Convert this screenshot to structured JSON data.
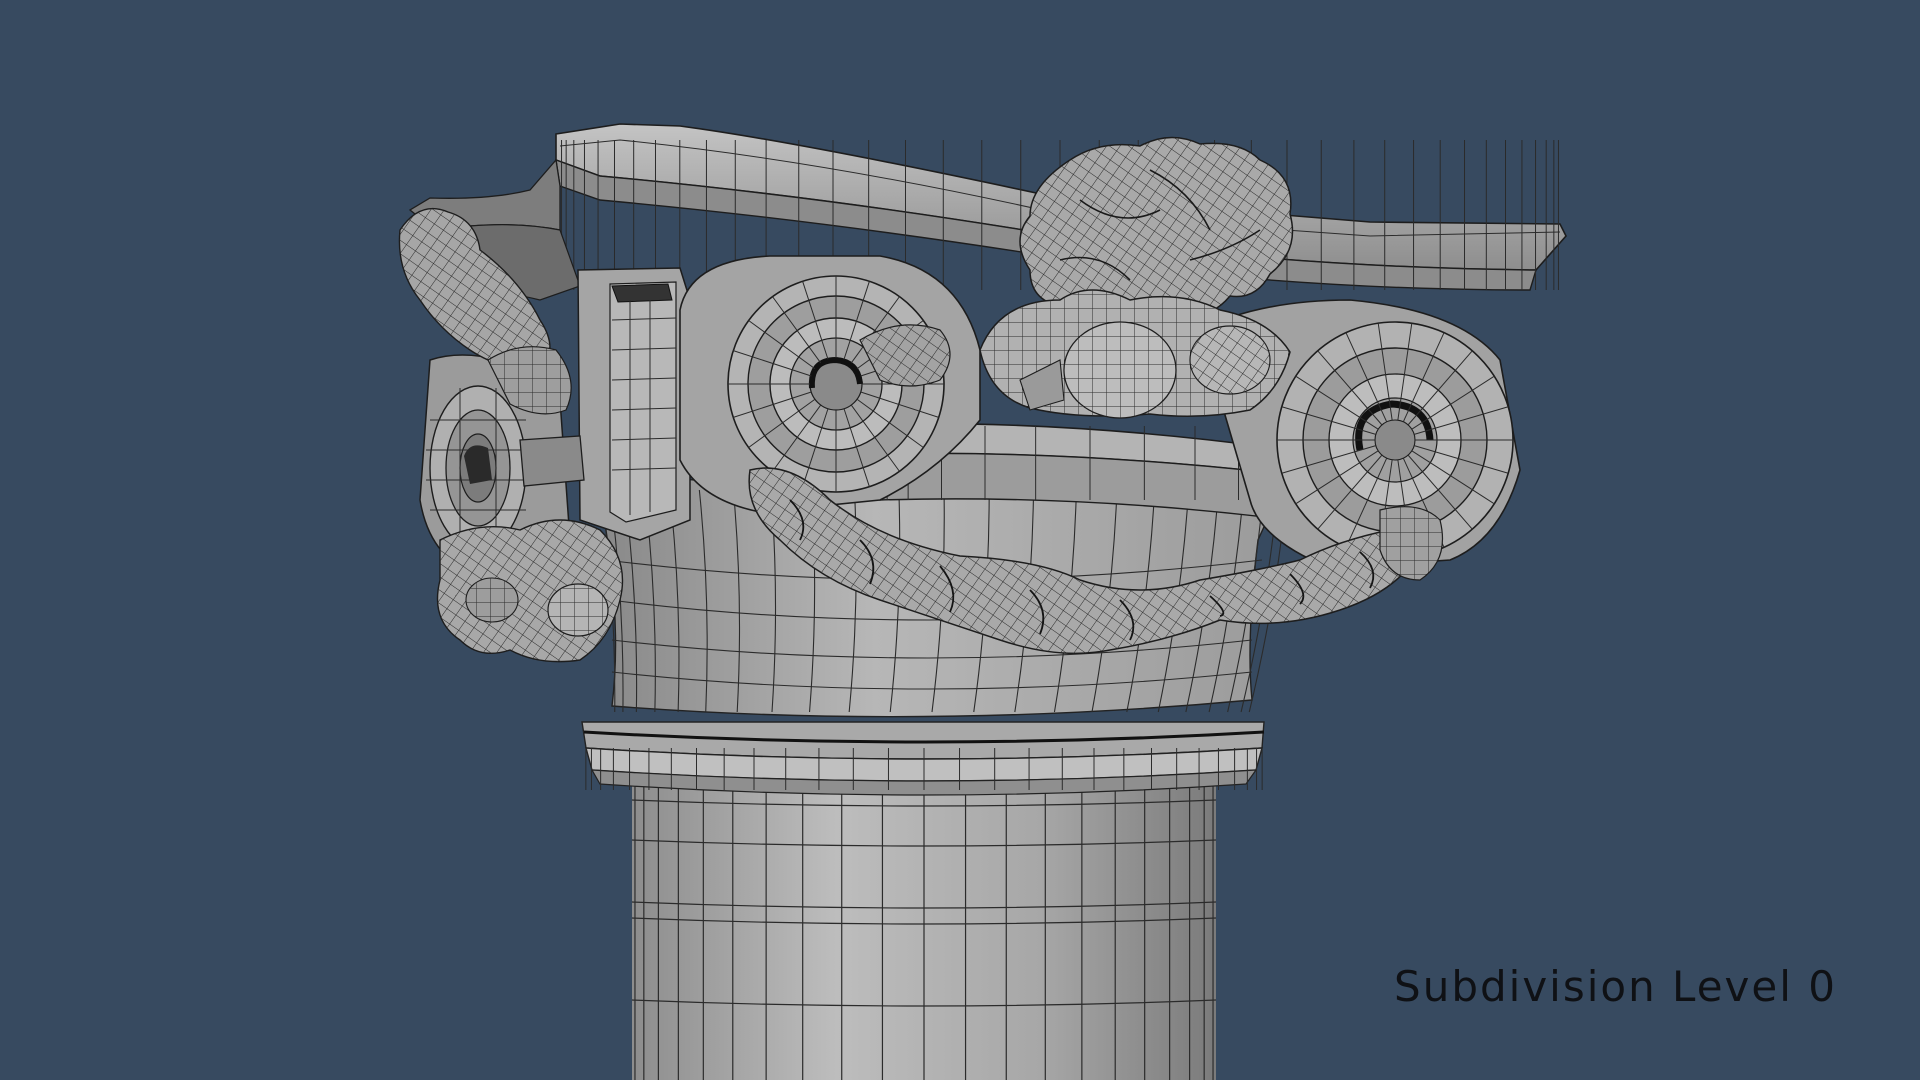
{
  "viewport": {
    "background": "#374a60",
    "caption": "Subdivision Level 0"
  },
  "model": {
    "subject": "column-capital",
    "display_mode": "shaded-wireframe",
    "colors": {
      "surface_light": "#b9b9b9",
      "surface_mid": "#9d9d9d",
      "surface_dark": "#6e6e6e",
      "wire": "#2a2a2a",
      "shadow": "#3a3a3a"
    }
  }
}
